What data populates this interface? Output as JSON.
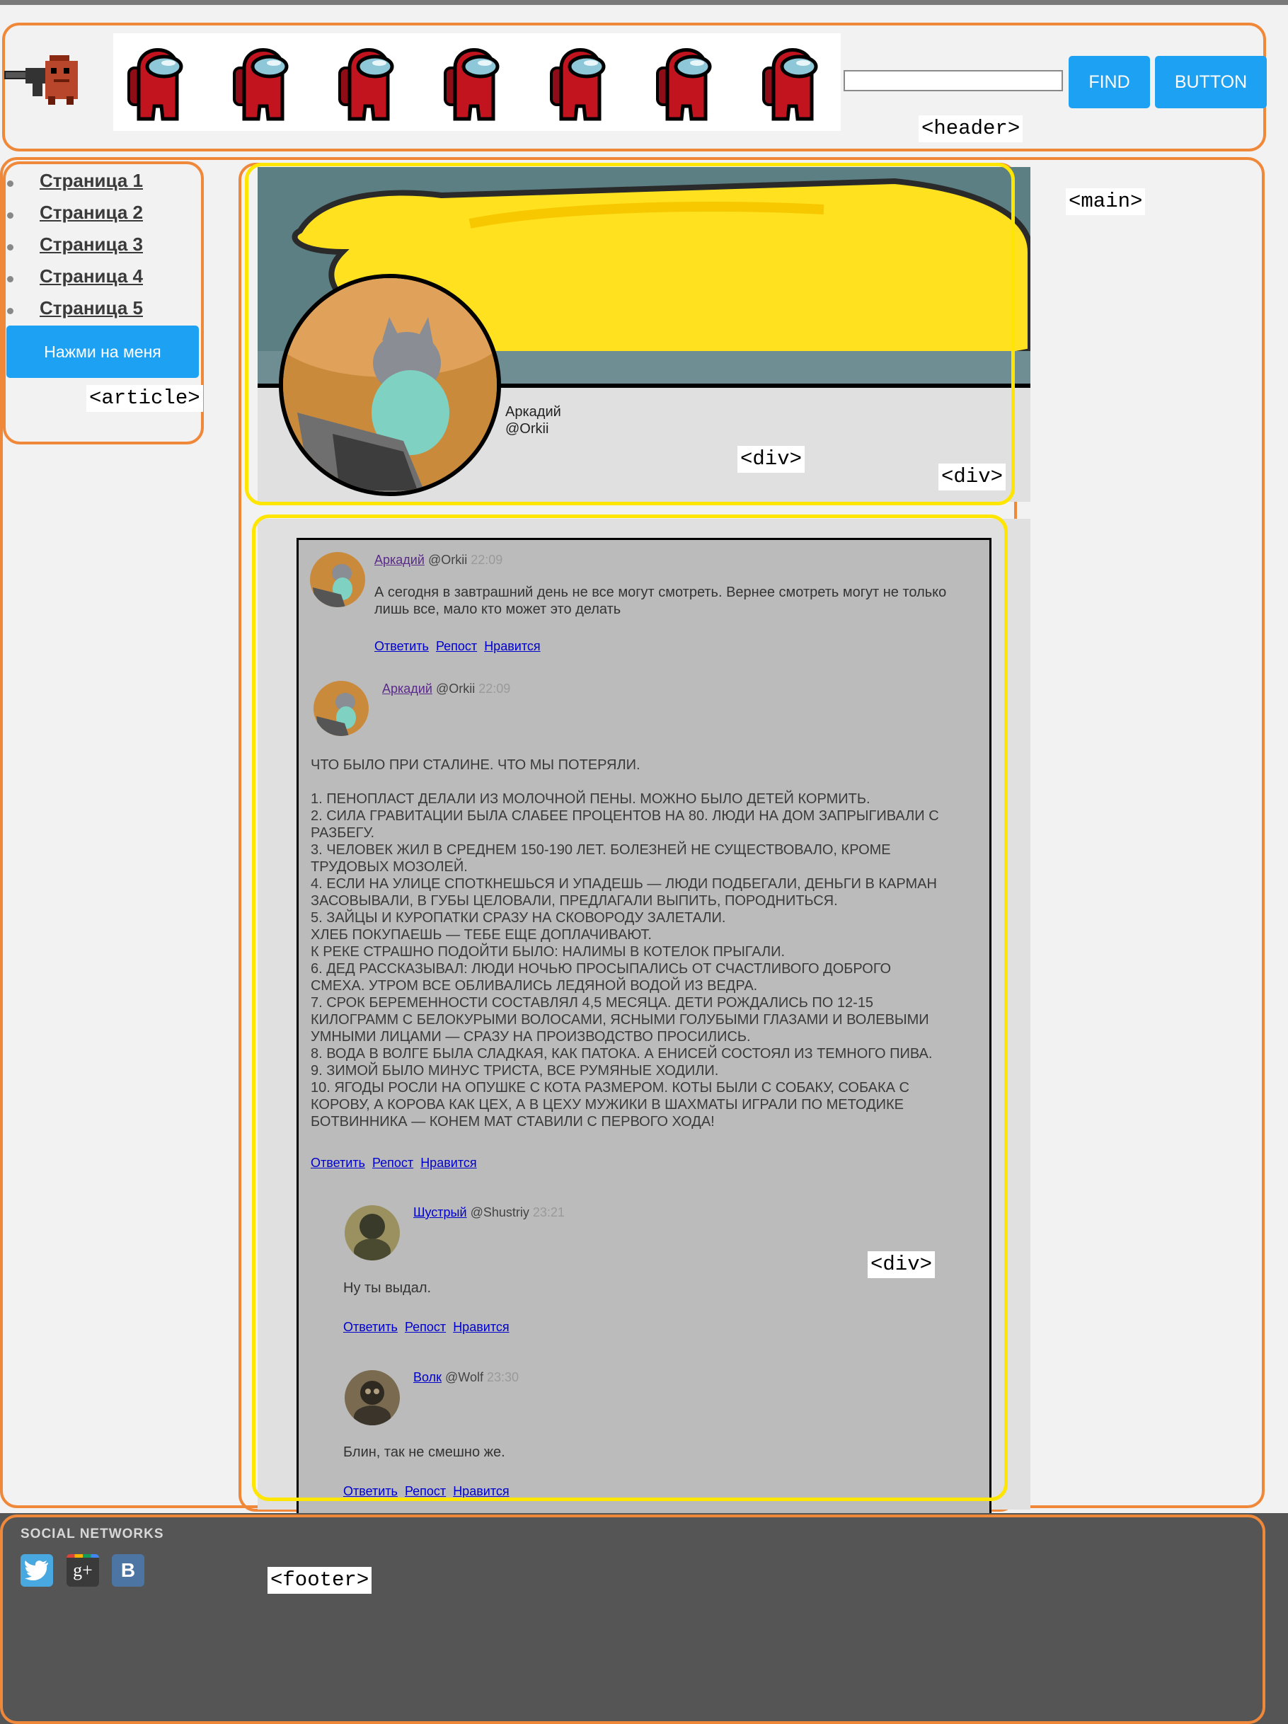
{
  "header": {
    "search_value": "",
    "find_label": "FIND",
    "button_label": "BUTTON",
    "tag": "<header>"
  },
  "sidebar": {
    "links": [
      "Страница 1",
      "Страница 2",
      "Страница 3",
      "Страница 4",
      "Страница 5"
    ],
    "button_label": "Нажми на меня",
    "tag": "<article>"
  },
  "main_tag": "<main>",
  "profile": {
    "name": "Аркадий",
    "handle": "@Orkii",
    "tag_inner": "<div>",
    "tag_outer": "<div>"
  },
  "feed": {
    "tag": "<div>",
    "posts": [
      {
        "author": "Аркадий",
        "handle": "@Orkii",
        "time": "22:09",
        "text": "А сегодня в завтрашний день не все могут смотреть. Вернее смотреть могут не только\nлишь все, мало кто может это делать",
        "actions": [
          "Ответить",
          "Репост",
          "Нравится"
        ]
      },
      {
        "author": "Аркадий",
        "handle": "@Orkii",
        "time": "22:09",
        "text": "ЧТО БЫЛО ПРИ СТАЛИНЕ. ЧТО МЫ ПОТЕРЯЛИ.\n\n1. ПЕНОПЛАСТ ДЕЛАЛИ ИЗ МОЛОЧНОЙ ПЕНЫ. МОЖНО БЫЛО ДЕТЕЙ КОРМИТЬ.\n2. СИЛА ГРАВИТАЦИИ БЫЛА СЛАБЕЕ ПРОЦЕНТОВ НА 80. ЛЮДИ НА ДОМ ЗАПРЫГИВАЛИ С\nРАЗБЕГУ.\n3. ЧЕЛОВЕК ЖИЛ В СРЕДНЕМ 150-190 ЛЕТ. БОЛЕЗНЕЙ НЕ СУЩЕСТВОВАЛО, КРОМЕ\nТРУДОВЫХ МОЗОЛЕЙ.\n4. ЕСЛИ НА УЛИЦЕ СПОТКНЕШЬСЯ И УПАДЕШЬ — ЛЮДИ ПОДБЕГАЛИ, ДЕНЬГИ В КАРМАН\nЗАСОВЫВАЛИ, В ГУБЫ ЦЕЛОВАЛИ, ПРЕДЛАГАЛИ ВЫПИТЬ, ПОРОДНИТЬСЯ.\n5. ЗАЙЦЫ И КУРОПАТКИ СРАЗУ НА СКОВОРОДУ ЗАЛЕТАЛИ.\nХЛЕБ ПОКУПАЕШЬ — ТЕБЕ ЕЩЕ ДОПЛАЧИВАЮТ.\nК РЕКЕ СТРАШНО ПОДОЙТИ БЫЛО: НАЛИМЫ В КОТЕЛОК ПРЫГАЛИ.\n6. ДЕД РАССКАЗЫВАЛ: ЛЮДИ НОЧЬЮ ПРОСЫПАЛИСЬ ОТ СЧАСТЛИВОГО ДОБРОГО\nСМЕХА. УТРОМ ВСЕ ОБЛИВАЛИСЬ ЛЕДЯНОЙ ВОДОЙ ИЗ ВЕДРА.\n7. СРОК БЕРЕМЕННОСТИ СОСТАВЛЯЛ 4,5 МЕСЯЦА. ДЕТИ РОЖДАЛИСЬ ПО 12-15\nКИЛОГРАММ С БЕЛОКУРЫМИ ВОЛОСАМИ, ЯСНЫМИ ГОЛУБЫМИ ГЛАЗАМИ И ВОЛЕВЫМИ\nУМНЫМИ ЛИЦАМИ — СРАЗУ НА ПРОИЗВОДСТВО ПРОСИЛИСЬ.\n8. ВОДА В ВОЛГЕ БЫЛА СЛАДКАЯ, КАК ПАТОКА. А ЕНИСЕЙ СОСТОЯЛ ИЗ ТЕМНОГО ПИВА.\n9. ЗИМОЙ БЫЛО МИНУС ТРИСТА, ВСЕ РУМЯНЫЕ ХОДИЛИ.\n10. ЯГОДЫ РОСЛИ НА ОПУШКЕ С КОТА РАЗМЕРОМ. КОТЫ БЫЛИ С СОБАКУ, СОБАКА С\nКОРОВУ, А КОРОВА КАК ЦЕХ, А В ЦЕХУ МУЖИКИ В ШАХМАТЫ ИГРАЛИ ПО МЕТОДИКЕ\nБОТВИННИКА — КОНЕМ МАТ СТАВИЛИ С ПЕРВОГО ХОДА!",
        "actions": [
          "Ответить",
          "Репост",
          "Нравится"
        ]
      },
      {
        "author": "Шустрый",
        "handle": "@Shustriy",
        "time": "23:21",
        "text": "Ну ты выдал.",
        "actions": [
          "Ответить",
          "Репост",
          "Нравится"
        ]
      },
      {
        "author": "Волк",
        "handle": "@Wolf",
        "time": "23:30",
        "text": "Блин, так не смешно же.",
        "actions": [
          "Ответить",
          "Репост",
          "Нравится"
        ]
      }
    ]
  },
  "footer": {
    "title": "SOCIAL NETWORKS",
    "icons": [
      "twitter-icon",
      "google-plus-icon",
      "vk-icon"
    ],
    "tag": "<footer>"
  },
  "colors": {
    "accent_button": "#1da1f2",
    "outline_orange": "#f0883a",
    "outline_yellow": "#ffe600",
    "footer_bg": "#555555",
    "feed_bg": "#bbbbbb",
    "banner_yellow": "#ffe11f"
  }
}
